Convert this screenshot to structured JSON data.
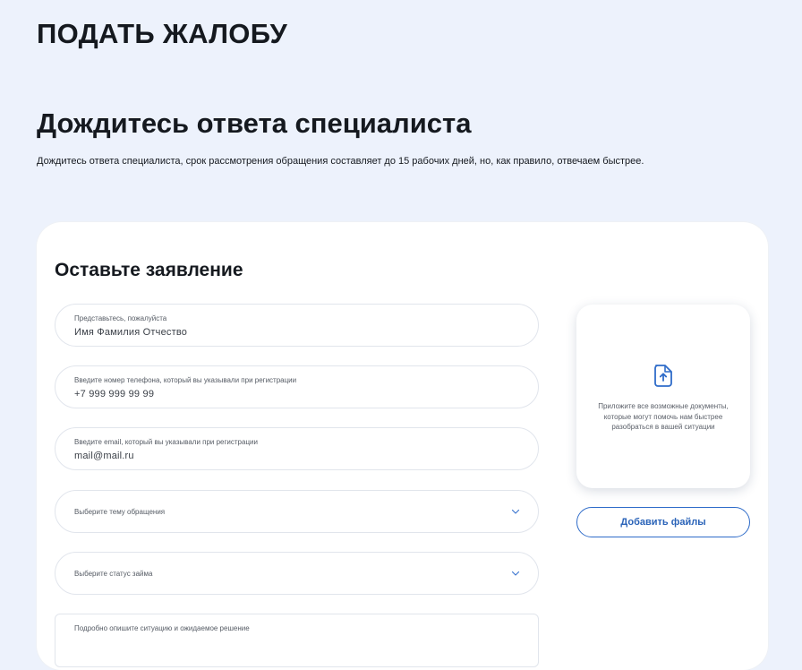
{
  "header": {
    "title": "ПОДАТЬ ЖАЛОБУ"
  },
  "section": {
    "title": "Дождитесь ответа специалиста",
    "description": "Дождитесь ответа специалиста, срок рассмотрения обращения составляет до 15 рабочих дней, но, как правило, отвечаем быстрее."
  },
  "form": {
    "title": "Оставьте заявление",
    "name_field": {
      "label": "Представьтесь, пожалуйста",
      "value": "Имя Фамилия Отчество"
    },
    "phone_field": {
      "label": "Введите номер телефона, который вы указывали при регистрации",
      "value": "+7 999 999 99 99"
    },
    "email_field": {
      "label": "Введите email, который вы указывали при регистрации",
      "value": "mail@mail.ru"
    },
    "topic_select": {
      "placeholder": "Выберите тему обращения"
    },
    "status_select": {
      "placeholder": "Выберите статус займа"
    },
    "description_field": {
      "label": "Подробно опишите ситуацию и ожидаемое решение"
    }
  },
  "upload": {
    "icon": "file-upload-icon",
    "text": "Приложите все возможные документы, которые могут помочь нам быстрее разобраться в вашей ситуации",
    "button_label": "Добавить файлы"
  },
  "colors": {
    "background": "#edf2fc",
    "accent": "#2a63b8",
    "text": "#15191f"
  }
}
